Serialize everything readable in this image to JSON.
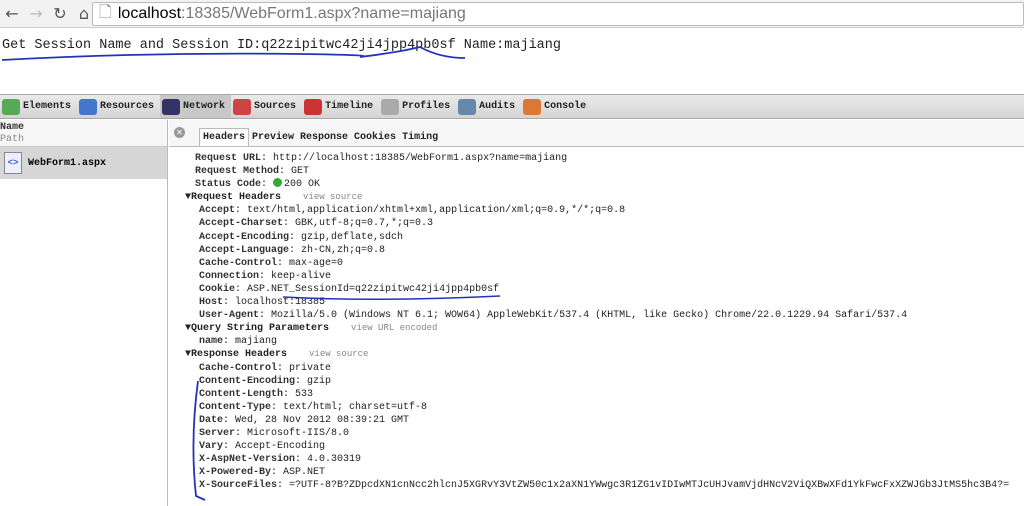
{
  "browser": {
    "url_host": "localhost",
    "url_rest": ":18385/WebForm1.aspx?name=majiang"
  },
  "page": {
    "text": "Get Session Name and Session ID:q22zipitwc42ji4jpp4pb0sf Name:majiang"
  },
  "devtools": {
    "tools": [
      "Elements",
      "Resources",
      "Network",
      "Sources",
      "Timeline",
      "Profiles",
      "Audits",
      "Console"
    ],
    "list_header": {
      "name": "Name",
      "path": "Path"
    },
    "file": "WebForm1.aspx",
    "tabs": [
      "Headers",
      "Preview",
      "Response",
      "Cookies",
      "Timing"
    ],
    "general": [
      [
        "Request URL",
        "http://localhost:18385/WebForm1.aspx?name=majiang"
      ],
      [
        "Request Method",
        "GET"
      ],
      [
        "Status Code",
        "200 OK"
      ]
    ],
    "request_headers_title": "Request Headers",
    "view_source": "view source",
    "request_headers": [
      [
        "Accept",
        "text/html,application/xhtml+xml,application/xml;q=0.9,*/*;q=0.8"
      ],
      [
        "Accept-Charset",
        "GBK,utf-8;q=0.7,*;q=0.3"
      ],
      [
        "Accept-Encoding",
        "gzip,deflate,sdch"
      ],
      [
        "Accept-Language",
        "zh-CN,zh;q=0.8"
      ],
      [
        "Cache-Control",
        "max-age=0"
      ],
      [
        "Connection",
        "keep-alive"
      ],
      [
        "Cookie",
        "ASP.NET_SessionId=q22zipitwc42ji4jpp4pb0sf"
      ],
      [
        "Host",
        "localhost:18385"
      ],
      [
        "User-Agent",
        "Mozilla/5.0 (Windows NT 6.1; WOW64) AppleWebKit/537.4 (KHTML, like Gecko) Chrome/22.0.1229.94 Safari/537.4"
      ]
    ],
    "query_title": "Query String Parameters",
    "view_url_encoded": "view URL encoded",
    "query": [
      [
        "name",
        "majiang"
      ]
    ],
    "response_headers_title": "Response Headers",
    "response_headers": [
      [
        "Cache-Control",
        "private"
      ],
      [
        "Content-Encoding",
        "gzip"
      ],
      [
        "Content-Length",
        "533"
      ],
      [
        "Content-Type",
        "text/html; charset=utf-8"
      ],
      [
        "Date",
        "Wed, 28 Nov 2012 08:39:21 GMT"
      ],
      [
        "Server",
        "Microsoft-IIS/8.0"
      ],
      [
        "Vary",
        "Accept-Encoding"
      ],
      [
        "X-AspNet-Version",
        "4.0.30319"
      ],
      [
        "X-Powered-By",
        "ASP.NET"
      ],
      [
        "X-SourceFiles",
        "=?UTF-8?B?ZDpcdXN1cnNcc2hlcnJ5XGRvY3VtZW50c1x2aXN1YWwgc3R1ZG1vIDIwMTJcUHJvamVjdHNcV2ViQXBwXFd1YkFwcFxXZWJGb3JtMS5hc3B4?="
      ]
    ]
  }
}
